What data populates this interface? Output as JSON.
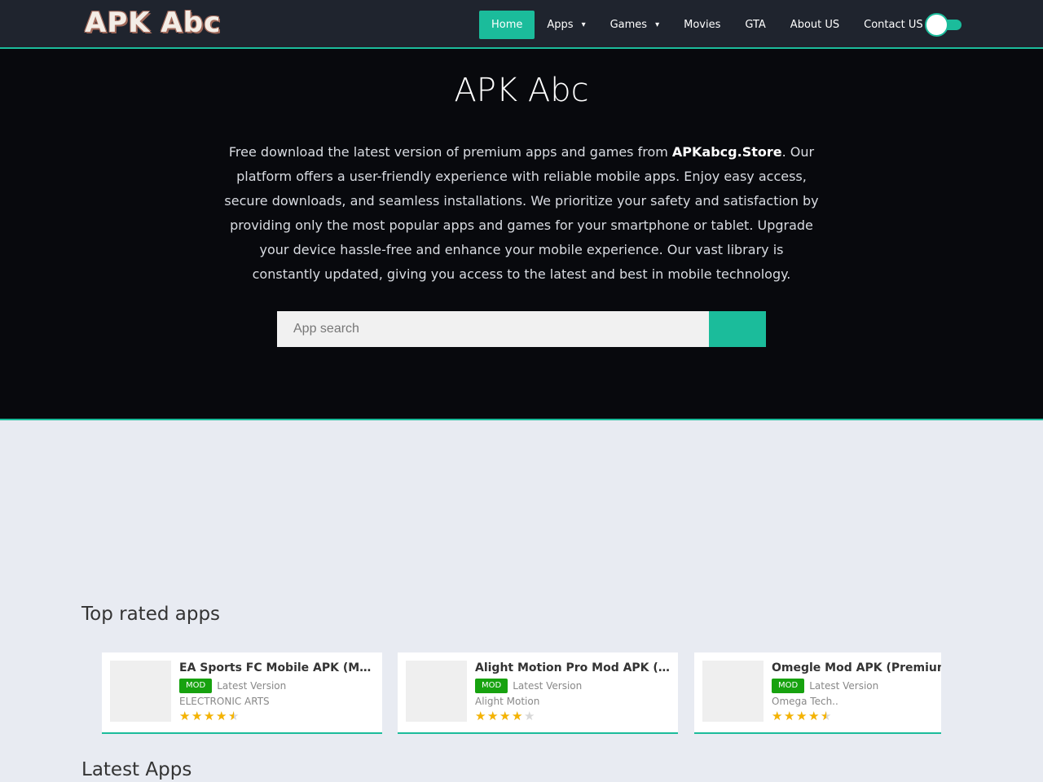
{
  "header": {
    "logo": "APK Abc",
    "nav": [
      {
        "label": "Home",
        "active": true,
        "dropdown": false
      },
      {
        "label": "Apps",
        "active": false,
        "dropdown": true
      },
      {
        "label": "Games",
        "active": false,
        "dropdown": true
      },
      {
        "label": "Movies",
        "active": false,
        "dropdown": false
      },
      {
        "label": "GTA",
        "active": false,
        "dropdown": false
      },
      {
        "label": "About US",
        "active": false,
        "dropdown": false
      },
      {
        "label": "Contact US",
        "active": false,
        "dropdown": false
      }
    ],
    "caret_icon": "chevron-down-icon",
    "theme_toggle": "dark-mode-toggle"
  },
  "hero": {
    "title": "APK Abc",
    "desc_before": "Free download the latest version of premium apps and games from ",
    "desc_brand": "APKabcg.Store",
    "desc_after": ". Our platform offers a user-friendly experience with reliable mobile apps. Enjoy easy access, secure downloads, and seamless installations. We prioritize your safety and satisfaction by providing only the most popular apps and games for your smartphone or tablet. Upgrade your device hassle-free and enhance your mobile experience. Our vast library is constantly updated, giving you access to the latest and best in mobile technology.",
    "search_placeholder": "App search"
  },
  "top_rated": {
    "title": "Top rated apps",
    "items": [
      {
        "title": "EA Sports FC Mobile APK (Mod Menu)",
        "badge": "MOD",
        "version": "Latest Version",
        "developer": "ELECTRONIC ARTS",
        "rating": 4.5
      },
      {
        "title": "Alight Motion Pro Mod APK (Premium Unlocked)",
        "badge": "MOD",
        "version": "Latest Version",
        "developer": "Alight Motion",
        "rating": 4
      },
      {
        "title": "Omegle Mod APK (Premium Unlocked)",
        "badge": "MOD",
        "version": "Latest Version",
        "developer": "Omega Tech..",
        "rating": 4.5
      }
    ]
  },
  "latest": {
    "title": "Latest Apps"
  },
  "colors": {
    "accent": "#1bbc9b",
    "header_bg": "#1f242e",
    "hero_bg": "#08090d",
    "page_bg": "#e8ebf2",
    "badge": "#17a20f",
    "star": "#f5b301"
  }
}
